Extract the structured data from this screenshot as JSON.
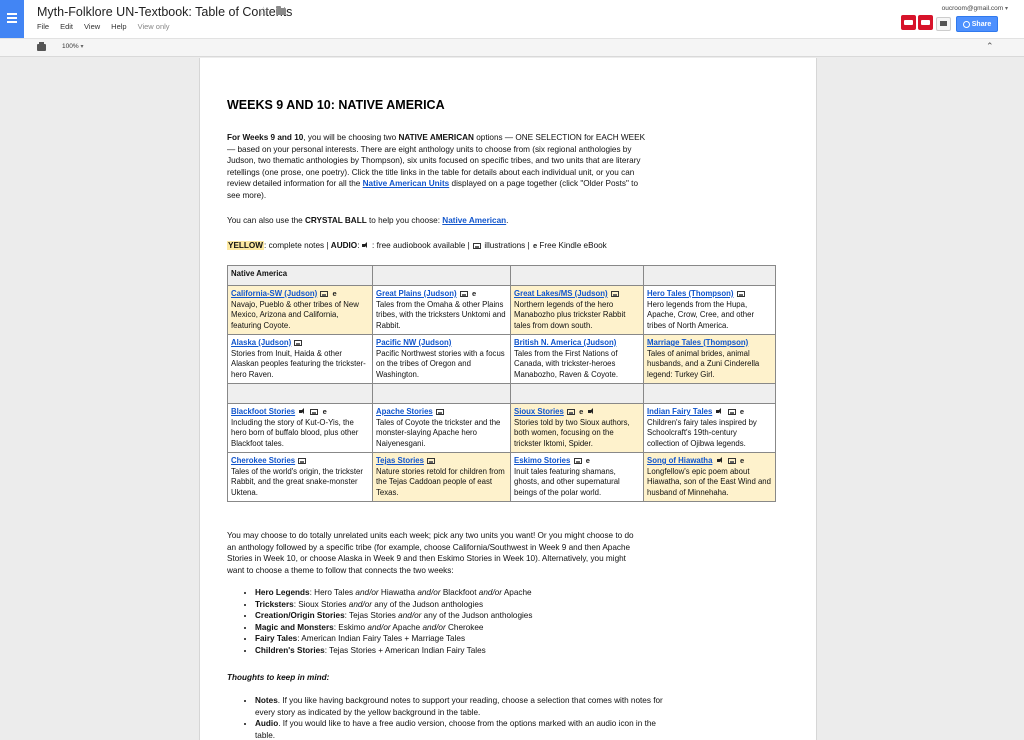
{
  "app": {
    "title": "Myth-Folklore UN-Textbook: Table of Contents",
    "menus": [
      "File",
      "Edit",
      "View",
      "Help"
    ],
    "view_only": "View only",
    "account_email": "oucroom@gmail.com",
    "account_caret": "▾",
    "share_label": "Share",
    "zoom_label": "100%",
    "zoom_caret": "▾",
    "accent_color": "#4285f4",
    "share_color": "#4d90fe"
  },
  "doc": {
    "heading": "WEEKS 9 AND 10: NATIVE AMERICA",
    "intro": {
      "lead_bold": "For Weeks 9 and 10",
      "lead_rest": ", you will be choosing two ",
      "bold_options": "NATIVE AMERICAN",
      "body": " options — ONE SELECTION for EACH WEEK — based on your personal interests. There are eight anthology units to choose from (six regional anthologies by Judson, two thematic anthologies by Thompson), six units focused on specific tribes, and two units that are literary retellings (one prose, one poetry). Click the title links in the table for details about each individual unit, or you can review detailed information for all the ",
      "link": "Native American Units",
      "tail": " displayed on a page together (click \"Older Posts\" to see more)."
    },
    "crystal": {
      "pre": "You can also use the ",
      "bold": "CRYSTAL BALL",
      "mid": " to help you choose: ",
      "link": "Native American",
      "end": "."
    },
    "legend": {
      "yellow": "YELLOW",
      "notes": ": complete notes | ",
      "audio": "AUDIO",
      "audio_text": ": free audiobook available | ",
      "illus": "illustrations | ",
      "kindle": "Free Kindle eBook",
      "kindle_glyph": "e",
      "highlight_color": "#fde9a1"
    },
    "table": {
      "header": "Native America",
      "row1": [
        {
          "title": "California-SW (Judson)",
          "icons": [
            "img",
            "kindle"
          ],
          "desc": "Navajo, Pueblo & other tribes of New Mexico, Arizona and California, featuring Coyote.",
          "yellow": true
        },
        {
          "title": "Great Plains (Judson)",
          "icons": [
            "img",
            "kindle"
          ],
          "desc": "Tales from the Omaha & other Plains tribes, with the tricksters Unktomi and Rabbit.",
          "yellow": false
        },
        {
          "title": "Great Lakes/MS (Judson)",
          "icons": [
            "img"
          ],
          "desc": "Northern legends of the hero Manabozho plus trickster Rabbit tales from down south.",
          "yellow": true
        },
        {
          "title": "Hero Tales (Thompson)",
          "icons": [
            "img"
          ],
          "desc": "Hero legends from the Hupa, Apache, Crow, Cree, and other tribes of North America.",
          "yellow": false
        }
      ],
      "row2": [
        {
          "title": "Alaska (Judson)",
          "icons": [
            "img"
          ],
          "desc": "Stories from Inuit, Haida & other Alaskan peoples featuring the trickster-hero Raven.",
          "yellow": false
        },
        {
          "title": "Pacific NW (Judson)",
          "icons": [],
          "desc": "Pacific Northwest stories with a focus on the tribes of Oregon and Washington.",
          "yellow": false
        },
        {
          "title": "British N. America (Judson)",
          "icons": [],
          "desc": "Tales from the First Nations of Canada, with trickster-heroes Manabozho, Raven & Coyote.",
          "yellow": false
        },
        {
          "title": "Marriage Tales (Thompson)",
          "icons": [],
          "desc": "Tales of animal brides, animal husbands, and a Zuni Cinderella legend: Turkey Girl.",
          "yellow": true
        }
      ],
      "row3": [
        {
          "title": "Blackfoot Stories",
          "icons": [
            "audio",
            "img",
            "kindle"
          ],
          "desc": "Including the story of Kut-O-Yis, the hero born of buffalo blood, plus other Blackfoot tales.",
          "yellow": false
        },
        {
          "title": "Apache Stories",
          "icons": [
            "img"
          ],
          "desc": "Tales of Coyote the trickster and the monster-slaying Apache hero Naiyenesgani.",
          "yellow": false
        },
        {
          "title": "Sioux Stories",
          "icons": [
            "img",
            "kindle",
            "audio"
          ],
          "desc": "Stories told by two Sioux authors, both women, focusing on the trickster Iktomi, Spider.",
          "yellow": true
        },
        {
          "title": "Indian Fairy Tales",
          "icons": [
            "audio",
            "img",
            "kindle"
          ],
          "desc": "Children's fairy tales inspired by Schoolcraft's 19th-century collection of Ojibwa legends.",
          "yellow": false
        }
      ],
      "row4": [
        {
          "title": "Cherokee Stories",
          "icons": [
            "img"
          ],
          "desc": "Tales of the world's origin, the trickster Rabbit, and the great snake-monster Uktena.",
          "yellow": false
        },
        {
          "title": "Tejas Stories",
          "icons": [
            "img"
          ],
          "desc": "Nature stories retold for children from the Tejas Caddoan people of east Texas.",
          "yellow": true
        },
        {
          "title": "Eskimo Stories",
          "icons": [
            "img",
            "kindle"
          ],
          "desc": "Inuit tales featuring shamans, ghosts, and other supernatural beings of the polar world.",
          "yellow": false
        },
        {
          "title": "Song of Hiawatha",
          "icons": [
            "audio",
            "img",
            "kindle"
          ],
          "desc": "Longfellow's epic poem about Hiawatha, son of the East Wind and husband of Minnehaha.",
          "yellow": true
        }
      ]
    },
    "after_table": "You may choose to do totally unrelated units each week; pick any two units you want! Or you might choose to do an anthology followed by a specific tribe (for example, choose California/Southwest in Week 9 and then Apache Stories in Week 10, or choose Alaska in Week 9 and then Eskimo Stories in Week 10). Alternatively, you might want to choose a theme to follow that connects the two weeks:",
    "themes": [
      {
        "label": "Hero Legends",
        "parts": [
          ": Hero Tales ",
          "and/or",
          " Hiawatha ",
          "and/or",
          " Blackfoot ",
          "and/or",
          " Apache"
        ]
      },
      {
        "label": "Tricksters",
        "parts": [
          ": Sioux Stories ",
          "and/or",
          " any of the Judson anthologies"
        ]
      },
      {
        "label": "Creation/Origin Stories",
        "parts": [
          ": Tejas Stories ",
          "and/or",
          " any of the Judson anthologies"
        ]
      },
      {
        "label": "Magic and Monsters",
        "parts": [
          ": Eskimo ",
          "and/or",
          " Apache ",
          "and/or",
          " Cherokee"
        ]
      },
      {
        "label": "Fairy Tales",
        "parts": [
          ": American Indian Fairy Tales + Marriage Tales"
        ]
      },
      {
        "label": "Children's Stories",
        "parts": [
          ": Tejas Stories + American Indian Fairy Tales"
        ]
      }
    ],
    "thoughts_heading": "Thoughts to keep in mind:",
    "thoughts": [
      {
        "label": "Notes",
        "text": ". If you like having background notes to support your reading, choose a selection that comes with notes for every story as indicated by the yellow background in the table."
      },
      {
        "label": "Audio",
        "text": ". If you would like to have a free audio version, choose from the options marked with an audio icon in the table."
      }
    ]
  }
}
